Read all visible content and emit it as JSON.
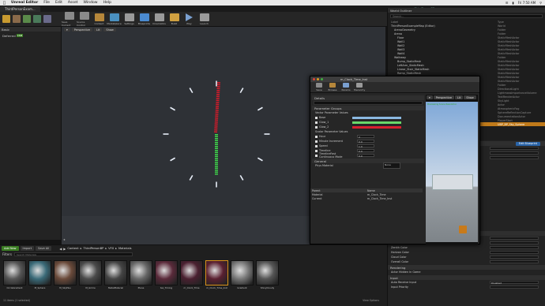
{
  "menubar": {
    "app": "Unreal Editor",
    "items": [
      "File",
      "Edit",
      "Asset",
      "Window",
      "Help"
    ],
    "time": "Fri 7:50 AM"
  },
  "tabs": {
    "level": "ThirdPersonExam...",
    "project": "ThirdPersonBP"
  },
  "toolbar": [
    {
      "label": "Save Current",
      "color": "#8a8a8a"
    },
    {
      "label": "Source Control",
      "color": "#8a8a8a"
    },
    {
      "label": "Content",
      "color": "#b6873a"
    },
    {
      "label": "Marketplace",
      "color": "#4a90c0"
    },
    {
      "label": "Settings",
      "color": "#9a9a9a"
    },
    {
      "label": "Blueprints",
      "color": "#4a8ad0"
    },
    {
      "label": "Cinematics",
      "color": "#9a9a9a"
    },
    {
      "label": "Build",
      "color": "#d0a040"
    },
    {
      "label": "Play",
      "color": "#7aa0d0"
    },
    {
      "label": "Launch",
      "color": "#9a9a9a"
    }
  ],
  "left_panel": {
    "title": "Basic",
    "item": "Deferred",
    "badge": "CSM"
  },
  "viewport": {
    "buttons": [
      "Perspective",
      "Lit",
      "Show"
    ]
  },
  "outliner": {
    "title": "World Outliner",
    "search_placeholder": "Search...",
    "col_label": "Label",
    "col_type": "Type",
    "rows": [
      {
        "label": "ThirdPersonExampleMap (Editor)",
        "type": "World"
      },
      {
        "label": "ArenaGeometry",
        "type": "Folder"
      },
      {
        "label": "Arena",
        "type": "Folder"
      },
      {
        "label": "Floor",
        "type": "StaticMeshActor"
      },
      {
        "label": "Wall1",
        "type": "StaticMeshActor"
      },
      {
        "label": "Wall2",
        "type": "StaticMeshActor"
      },
      {
        "label": "Wall3",
        "type": "StaticMeshActor"
      },
      {
        "label": "Wall4",
        "type": "StaticMeshActor"
      },
      {
        "label": "Walkway",
        "type": "Folder"
      },
      {
        "label": "Bump_StaticMesh",
        "type": "StaticMeshActor"
      },
      {
        "label": "LeftArm_StaticMesh",
        "type": "StaticMeshActor"
      },
      {
        "label": "Linear_Stair_StaticMesh",
        "type": "StaticMeshActor"
      },
      {
        "label": "Ramp_StaticMesh",
        "type": "StaticMeshActor"
      },
      {
        "label": "",
        "type": "StaticMeshActor"
      },
      {
        "label": "",
        "type": "StaticMeshActor"
      },
      {
        "label": "",
        "type": "Folder"
      },
      {
        "label": "",
        "type": "DirectionalLight"
      },
      {
        "label": "",
        "type": "LightmassImportanceVolume"
      },
      {
        "label": "",
        "type": "TextRenderActor"
      },
      {
        "label": "",
        "type": "SkyLight"
      },
      {
        "label": "",
        "type": "Actor"
      },
      {
        "label": "",
        "type": "AtmosphericFog"
      },
      {
        "label": "",
        "type": "SphereReflectionCapture"
      },
      {
        "label": "",
        "type": "DocumentationActor"
      },
      {
        "label": "",
        "type": "PlayerStart"
      },
      {
        "label": "",
        "type": "UBP_BP_Sky_Sphere",
        "selected": true
      }
    ]
  },
  "details": {
    "title": "Details",
    "edit_blueprint": "Edit Blueprint",
    "rows": [
      "Location",
      "Rotation",
      "Scale"
    ],
    "section_material": "Materials",
    "section_rendering": "Rendering",
    "section_input": "Input",
    "fields": [
      "Sun Height",
      "Horizon Falloff",
      "Zenith Color",
      "Horizon Color",
      "Cloud Color",
      "Overall Color"
    ],
    "render_rows": [
      "Actor Hidden In Game",
      "Auto Receive Input",
      "Input Priority"
    ],
    "auto_value": "Disabled"
  },
  "material_editor": {
    "title": "m_Clock_Time_Inst",
    "tools": [
      {
        "label": "Save",
        "color": "#8a8a8a"
      },
      {
        "label": "Browse",
        "color": "#b6873a"
      },
      {
        "label": "Params",
        "color": "#7aa0d0"
      },
      {
        "label": "Hierarchy",
        "color": "#9a9a9a"
      }
    ],
    "details_tab": "Details",
    "section_groups": "Parameter Groups",
    "vector_group": "Vector Parameter Values",
    "vectors": [
      {
        "name": "Base",
        "color": "#8ab8e0"
      },
      {
        "name": "Glow_1",
        "color": "#6ad86a"
      },
      {
        "name": "Glow_2",
        "color": "#d82030"
      }
    ],
    "scalar_group": "Scalar Parameter Values",
    "scalars": [
      {
        "name": "Hour",
        "value": "2"
      },
      {
        "name": "Minute Increment",
        "value": "0.0"
      },
      {
        "name": "Speed",
        "value": "1.0"
      },
      {
        "name": "Timeline",
        "value": "0.0"
      },
      {
        "name": "TimelineFast Continuous Mode",
        "value": "0.0"
      }
    ],
    "general": "General",
    "phys_material": "Phys Material",
    "phys_value": "None",
    "parent_col": "Parent",
    "name_col": "Name",
    "parent_rows": [
      {
        "k": "Material",
        "v": "m_Clock_Time"
      },
      {
        "k": "Current",
        "v": "m_Clock_Time_Inst"
      }
    ],
    "preview_buttons": [
      "Perspective",
      "Lit",
      "Show"
    ],
    "preview_caption": "Previewing Scene Resolution"
  },
  "content_browser": {
    "add_new": "Add New",
    "import": "Import",
    "save_all": "Save All",
    "path": [
      "Content",
      "ThirdPersonBP",
      "VFX",
      "Materials"
    ],
    "filters": "Filters",
    "search_placeholder": "Search Materials",
    "assets": [
      {
        "name": "CircleGradient",
        "bg": "#555"
      },
      {
        "name": "M_Sphere",
        "bg": "#3a6a78"
      },
      {
        "name": "M_SkyPlus",
        "bg": "#6a4a3a"
      },
      {
        "name": "M_Grime",
        "bg": "#4a4a4a"
      },
      {
        "name": "MetalMaterial",
        "bg": "#444"
      },
      {
        "name": "Plane",
        "bg": "#666"
      },
      {
        "name": "tex_Timing",
        "bg": "#5a2a3a"
      },
      {
        "name": "m_Clock_Time",
        "bg": "#4a2030"
      },
      {
        "name": "m_Clock_Time_Inst",
        "bg": "#5a2030",
        "selected": true
      },
      {
        "name": "Gradient",
        "bg": "#777"
      },
      {
        "name": "ShinyCloudy",
        "bg": "#555"
      }
    ],
    "status": "11 items (1 selected)",
    "view_options": "View Options"
  }
}
